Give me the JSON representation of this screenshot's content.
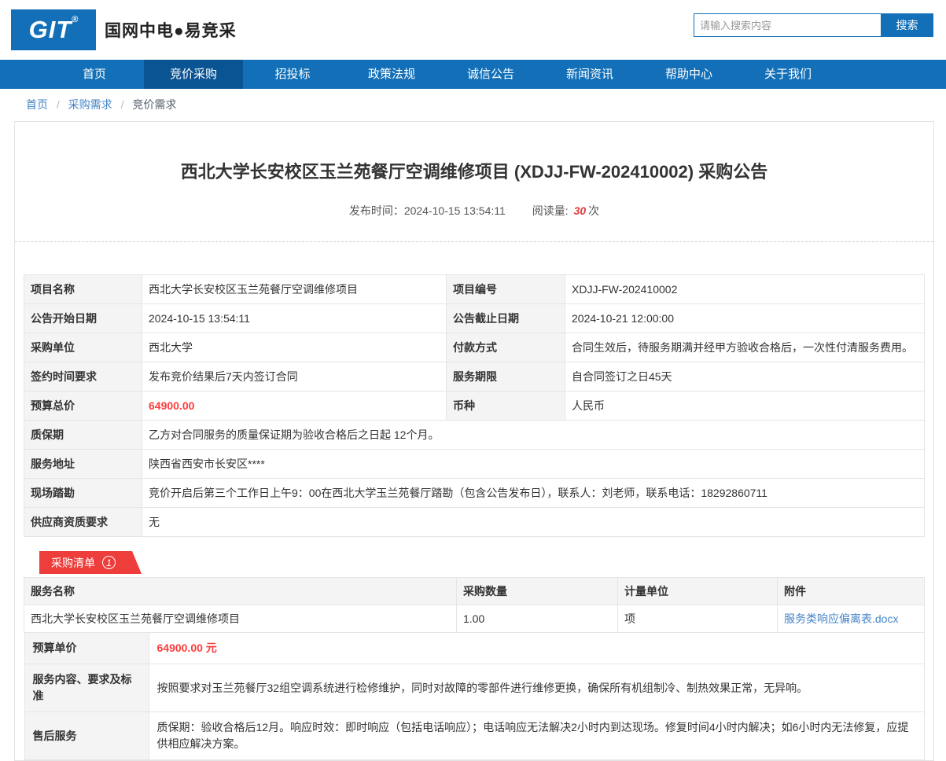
{
  "header": {
    "logo_text": "GIT",
    "logo_reg": "®",
    "brand": "国网中电●易竞采",
    "search": {
      "placeholder": "请输入搜索内容",
      "button": "搜索"
    }
  },
  "nav": {
    "items": [
      {
        "label": "首页",
        "active": false
      },
      {
        "label": "竞价采购",
        "active": true
      },
      {
        "label": "招投标",
        "active": false
      },
      {
        "label": "政策法规",
        "active": false
      },
      {
        "label": "诚信公告",
        "active": false
      },
      {
        "label": "新闻资讯",
        "active": false
      },
      {
        "label": "帮助中心",
        "active": false
      },
      {
        "label": "关于我们",
        "active": false
      }
    ]
  },
  "breadcrumb": {
    "separator": "/",
    "items": [
      "首页",
      "采购需求",
      "竞价需求"
    ]
  },
  "announcement": {
    "title": "西北大学长安校区玉兰苑餐厅空调维修项目 (XDJJ-FW-202410002) 采购公告",
    "publish_label": "发布时间：",
    "publish_time": "2024-10-15 13:54:11",
    "views_label": "阅读量:",
    "views_count": "30",
    "views_unit": "次"
  },
  "info_table": {
    "rows4": [
      {
        "l1": "项目名称",
        "v1": "西北大学长安校区玉兰苑餐厅空调维修项目",
        "l2": "项目编号",
        "v2": "XDJJ-FW-202410002"
      },
      {
        "l1": "公告开始日期",
        "v1": "2024-10-15 13:54:11",
        "l2": "公告截止日期",
        "v2": "2024-10-21 12:00:00"
      },
      {
        "l1": "采购单位",
        "v1": "西北大学",
        "l2": "付款方式",
        "v2": "合同生效后，待服务期满并经甲方验收合格后，一次性付清服务费用。"
      },
      {
        "l1": "签约时间要求",
        "v1": "发布竞价结果后7天内签订合同",
        "l2": "服务期限",
        "v2": "自合同签订之日45天"
      },
      {
        "l1": "预算总价",
        "v1": "64900.00",
        "l2": "币种",
        "v2": "人民币"
      }
    ],
    "rows_full": [
      {
        "label": "质保期",
        "value": "乙方对合同服务的质量保证期为验收合格后之日起 12个月。"
      },
      {
        "label": "服务地址",
        "value": "陕西省西安市长安区****"
      },
      {
        "label": "现场踏勘",
        "value": "竞价开启后第三个工作日上午9：00在西北大学玉兰苑餐厅踏勘（包含公告发布日），联系人：刘老师，联系电话：18292860711"
      },
      {
        "label": "供应商资质要求",
        "value": "无"
      }
    ]
  },
  "list_section": {
    "tab_label": "采购清单",
    "tab_count": "1",
    "headers": [
      "服务名称",
      "采购数量",
      "计量单位",
      "附件"
    ],
    "row": {
      "name": "西北大学长安校区玉兰苑餐厅空调维修项目",
      "qty": "1.00",
      "unit": "项",
      "attachment": "服务类响应偏离表.docx"
    },
    "details": [
      {
        "label": "预算单价",
        "value": "64900.00 元"
      },
      {
        "label": "服务内容、要求及标准",
        "value": "按照要求对玉兰苑餐厅32组空调系统进行检修维护，同时对故障的零部件进行维修更换，确保所有机组制冷、制热效果正常，无异响。"
      },
      {
        "label": "售后服务",
        "value": "质保期：验收合格后12月。响应时效：即时响应（包括电话响应）；电话响应无法解决2小时内到达现场。修复时间4小时内解决；如6小时内无法修复，应提供相应解决方案。"
      }
    ]
  },
  "colors": {
    "brand_blue": "#1370b8",
    "nav_active_blue": "#0b5494",
    "accent_red": "#ee3e3b",
    "price_red": "#fb3d3d",
    "link_blue": "#4585c6"
  }
}
